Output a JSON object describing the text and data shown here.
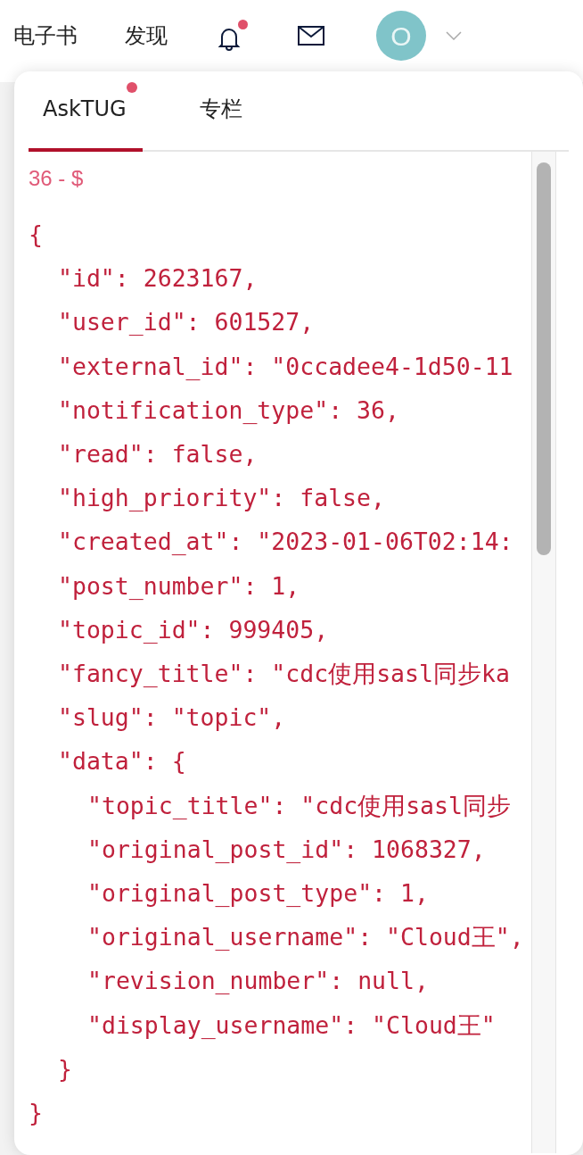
{
  "nav": {
    "items": [
      {
        "label": "电子书"
      },
      {
        "label": "发现"
      }
    ],
    "notification_unread": true,
    "avatar": {
      "letter": "O",
      "color": "#80c4c9"
    }
  },
  "panel": {
    "tabs": [
      {
        "label": "AskTUG",
        "selected": true,
        "unread": true
      },
      {
        "label": "专栏",
        "selected": false,
        "unread": false
      }
    ],
    "heading": "36 - $",
    "code": [
      {
        "text": "{",
        "children": [
          {
            "text": "\"id\": 2623167,"
          },
          {
            "text": "\"user_id\": 601527,"
          },
          {
            "text": "\"external_id\": \"0ccadee4-1d50-11"
          },
          {
            "text": "\"notification_type\": 36,"
          },
          {
            "text": "\"read\": false,"
          },
          {
            "text": "\"high_priority\": false,"
          },
          {
            "text": "\"created_at\": \"2023-01-06T02:14:"
          },
          {
            "text": "\"post_number\": 1,"
          },
          {
            "text": "\"topic_id\": 999405,"
          },
          {
            "text": "\"fancy_title\": \"cdc使用sasl同步ka"
          },
          {
            "text": "\"slug\": \"topic\","
          },
          {
            "text": "\"data\": {",
            "children": [
              {
                "text": "\"topic_title\": \"cdc使用sasl同步"
              },
              {
                "text": "\"original_post_id\": 1068327,"
              },
              {
                "text": "\"original_post_type\": 1,"
              },
              {
                "text": "\"original_username\": \"Cloud王\","
              },
              {
                "text": "\"revision_number\": null,"
              },
              {
                "text": "\"display_username\": \"Cloud王\""
              }
            ]
          },
          {
            "text": "}"
          }
        ]
      },
      {
        "text": "}"
      }
    ]
  }
}
